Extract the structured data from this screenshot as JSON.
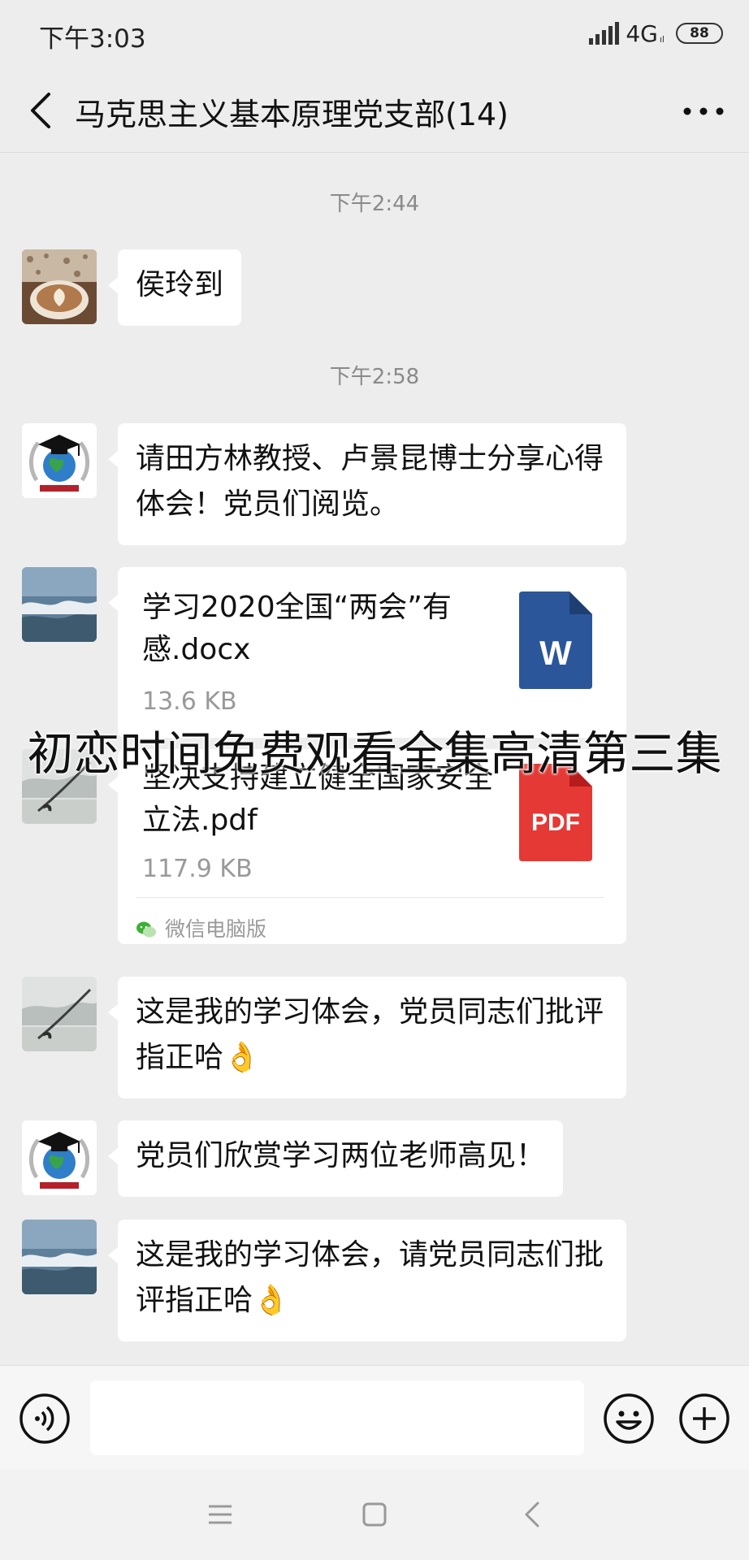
{
  "status_bar": {
    "time": "下午3:03",
    "network": "4G",
    "network_sub": "ıl",
    "battery": "88"
  },
  "header": {
    "title": "马克思主义基本原理党支部(14)",
    "back_icon": "back-arrow-icon",
    "more_icon": "more-dots-icon"
  },
  "timestamps": [
    "下午2:44",
    "下午2:58"
  ],
  "messages": [
    {
      "avatar": "coffee-latte-avatar",
      "text": "侯玲到"
    },
    {
      "avatar": "university-globe-avatar",
      "text": "请田方林教授、卢景昆博士分享心得体会！党员们阅览。"
    },
    {
      "avatar": "ocean-waves-avatar",
      "file_name": "学习2020全国“两会”有感.docx",
      "file_size": "13.6 KB",
      "file_icon": "word-doc-icon",
      "file_icon_label": "W"
    },
    {
      "avatar": "ink-painting-avatar",
      "file_name": "坚决支持建立健全国家安全立法.pdf",
      "file_size": "117.9 KB",
      "file_icon": "pdf-icon",
      "file_icon_label": "PDF",
      "source": "微信电脑版",
      "source_icon": "wechat-icon"
    },
    {
      "avatar": "ink-painting-avatar",
      "text": "这是我的学习体会，党员同志们批评指正哈👌"
    },
    {
      "avatar": "university-globe-avatar",
      "text": "党员们欣赏学习两位老师高见！"
    },
    {
      "avatar": "ocean-waves-avatar",
      "text": "这是我的学习体会，请党员同志们批评指正哈👌"
    }
  ],
  "overlay_text": "初恋时间免费观看全集高清第三集",
  "input_bar": {
    "voice_icon": "voice-icon",
    "input_value": "",
    "emoji_icon": "emoji-icon",
    "plus_icon": "plus-icon"
  },
  "nav_bar": {
    "items": [
      "menu-icon",
      "home-square-icon",
      "back-chevron-icon"
    ]
  },
  "colors": {
    "background": "#ededed",
    "bubble": "#ffffff",
    "word_blue": "#2b579a",
    "pdf_red": "#e53935",
    "timestamp_gray": "#8a8a8a"
  }
}
